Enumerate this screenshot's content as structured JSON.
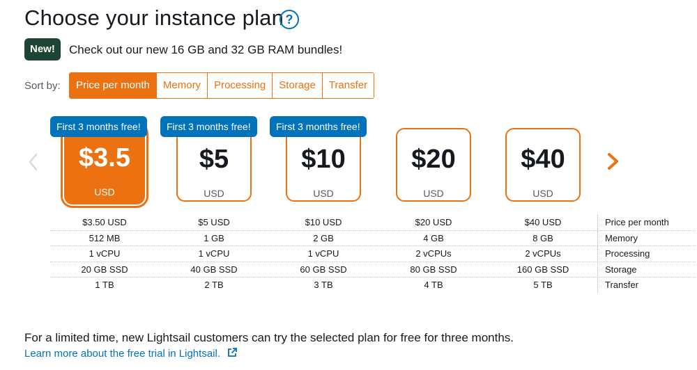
{
  "header": {
    "title": "Choose your instance plan",
    "help_glyph": "?"
  },
  "announcement": {
    "badge": "New!",
    "text": "Check out our new 16 GB and 32 GB RAM bundles!"
  },
  "sort": {
    "label": "Sort by:",
    "options": [
      "Price per month",
      "Memory",
      "Processing",
      "Storage",
      "Transfer"
    ],
    "active": "Price per month"
  },
  "plans": [
    {
      "price": "$3.5",
      "currency": "USD",
      "badge": "First 3 months free!",
      "selected": true,
      "specs": [
        "$3.50 USD",
        "512 MB",
        "1 vCPU",
        "20 GB SSD",
        "1 TB"
      ]
    },
    {
      "price": "$5",
      "currency": "USD",
      "badge": "First 3 months free!",
      "selected": false,
      "specs": [
        "$5 USD",
        "1 GB",
        "1 vCPU",
        "40 GB SSD",
        "2 TB"
      ]
    },
    {
      "price": "$10",
      "currency": "USD",
      "badge": "First 3 months free!",
      "selected": false,
      "specs": [
        "$10 USD",
        "2 GB",
        "1 vCPU",
        "60 GB SSD",
        "3 TB"
      ]
    },
    {
      "price": "$20",
      "currency": "USD",
      "badge": "",
      "selected": false,
      "specs": [
        "$20 USD",
        "4 GB",
        "2 vCPUs",
        "80 GB SSD",
        "4 TB"
      ]
    },
    {
      "price": "$40",
      "currency": "USD",
      "badge": "",
      "selected": false,
      "specs": [
        "$40 USD",
        "8 GB",
        "2 vCPUs",
        "160 GB SSD",
        "5 TB"
      ]
    }
  ],
  "spec_labels": [
    "Price per month",
    "Memory",
    "Processing",
    "Storage",
    "Transfer"
  ],
  "footer": {
    "info": "For a limited time, new Lightsail customers can try the selected plan for free for three months.",
    "link": "Learn more about the free trial in Lightsail."
  },
  "icons": {
    "help": "question-circle-icon",
    "prev": "chevron-left-icon",
    "next": "chevron-right-icon",
    "external": "external-link-icon"
  },
  "colors": {
    "accent": "#ec7211",
    "link": "#0073bb",
    "new_badge": "#1e4534",
    "free_badge": "#0073bb",
    "text": "#16191f"
  }
}
